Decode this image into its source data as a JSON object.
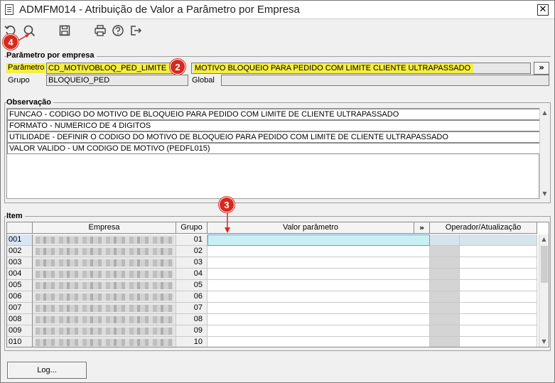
{
  "window": {
    "title": "ADMFM014 - Atribuição de Valor a Parâmetro por Empresa",
    "close_symbol": "✕"
  },
  "toolbar": {
    "icons": [
      "undo-icon",
      "search-icon",
      "save-icon",
      "print-icon",
      "help-icon",
      "exit-icon"
    ]
  },
  "callouts": {
    "c2": "2",
    "c3": "3",
    "c4": "4",
    "color": "#d62a1f"
  },
  "parametro_por_empresa": {
    "section_title": "Parâmetro por empresa",
    "parametro_label": "Parâmetro",
    "parametro_code": "CD_MOTIVOBLOQ_PED_LIMITE",
    "parametro_desc": "MOTIVO BLOQUEIO PARA PEDIDO COM LIMITE CLIENTE ULTRAPASSADO",
    "expand_button": "»",
    "grupo_label": "Grupo",
    "grupo_value": "BLOQUEIO_PED",
    "global_label": "Global",
    "global_value": "",
    "highlight_color": "#f6ee42"
  },
  "observacao": {
    "section_title": "Observação",
    "lines": [
      "FUNCAO - CODIGO DO MOTIVO DE BLOQUEIO PARA PEDIDO COM LIMITE DE CLIENTE ULTRAPASSADO",
      "FORMATO - NUMERICO DE 4 DIGITOS",
      "UTILIDADE - DEFINIR O CODIGO DO MOTIVO DE BLOQUEIO PARA PEDIDO COM LIMITE DE CLIENTE ULTRAPASSADO",
      "VALOR VALIDO - UM CODIGO DE MOTIVO (PEDFL015)"
    ]
  },
  "item": {
    "section_title": "Item",
    "columns": {
      "empresa": "Empresa",
      "grupo": "Grupo",
      "valor": "Valor parâmetro",
      "expand": "»",
      "operador": "Operador/Atualização"
    },
    "rows": [
      {
        "num": "001",
        "grupo": "01"
      },
      {
        "num": "002",
        "grupo": "02"
      },
      {
        "num": "003",
        "grupo": "03"
      },
      {
        "num": "004",
        "grupo": "04"
      },
      {
        "num": "005",
        "grupo": "05"
      },
      {
        "num": "006",
        "grupo": "06"
      },
      {
        "num": "007",
        "grupo": "07"
      },
      {
        "num": "008",
        "grupo": "08"
      },
      {
        "num": "009",
        "grupo": "09"
      },
      {
        "num": "010",
        "grupo": "10"
      }
    ]
  },
  "footer": {
    "log_button": "Log..."
  }
}
